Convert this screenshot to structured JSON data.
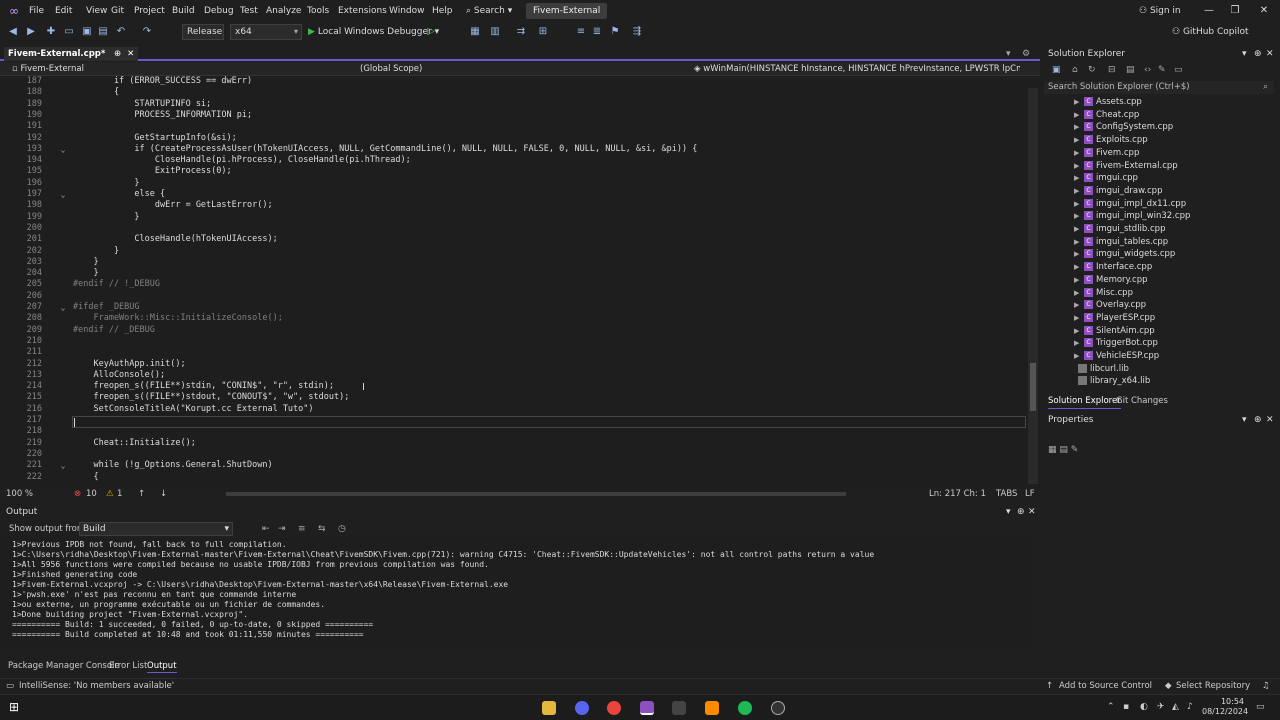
{
  "menubar": {
    "items": [
      "File",
      "Edit",
      "View",
      "Git",
      "Project",
      "Build",
      "Debug",
      "Test",
      "Analyze",
      "Tools",
      "Extensions",
      "Window",
      "Help"
    ],
    "search_label": "Search",
    "solution_title": "Fivem-External",
    "sign_in": "Sign in"
  },
  "toolbar": {
    "config": "Release",
    "platform": "x64",
    "run_target": "Local Windows Debugger",
    "copilot": "GitHub Copilot"
  },
  "document": {
    "tab_label": "Fivem-External.cpp*",
    "nav_project": "Fivem-External",
    "nav_scope": "(Global Scope)",
    "nav_function": "wWinMain(HINSTANCE hInstance, HINSTANCE hPrevInstance, LPWSTR lpCmdLine, int nC"
  },
  "editor": {
    "line_numbers": [
      "187",
      "188",
      "189",
      "190",
      "191",
      "192",
      "193",
      "194",
      "195",
      "196",
      "197",
      "198",
      "199",
      "200",
      "201",
      "202",
      "203",
      "204",
      "205",
      "206",
      "207",
      "208",
      "209",
      "210",
      "211",
      "212",
      "213",
      "214",
      "215",
      "216",
      "217",
      "218",
      "219",
      "220",
      "221",
      "222"
    ],
    "lines": [
      "        if (ERROR_SUCCESS == dwErr)",
      "        {",
      "            STARTUPINFO si;",
      "            PROCESS_INFORMATION pi;",
      "",
      "            GetStartupInfo(&si);",
      "            if (CreateProcessAsUser(hTokenUIAccess, NULL, GetCommandLine(), NULL, NULL, FALSE, 0, NULL, NULL, &si, &pi)) {",
      "                CloseHandle(pi.hProcess), CloseHandle(pi.hThread);",
      "                ExitProcess(0);",
      "            }",
      "            else {",
      "                dwErr = GetLastError();",
      "            }",
      "",
      "            CloseHandle(hTokenUIAccess);",
      "        }",
      "    }",
      "    }",
      "#endif // !_DEBUG",
      "",
      "#ifdef _DEBUG",
      "    FrameWork::Misc::InitializeConsole();",
      "#endif // _DEBUG",
      "",
      "",
      "    KeyAuthApp.init();",
      "    AlloConsole();",
      "    freopen_s((FILE**)stdin, \"CONIN$\", \"r\", stdin);",
      "    freopen_s((FILE**)stdout, \"CONOUT$\", \"w\", stdout);",
      "    SetConsoleTitleA(\"Korupt.cc External Tuto\")",
      "",
      "",
      "    Cheat::Initialize();",
      "",
      "    while (!g_Options.General.ShutDown)",
      "    {"
    ]
  },
  "editor_status": {
    "zoom": "100 %",
    "errors": "10",
    "warnings": "1",
    "position": "Ln: 217   Ch: 1",
    "tabs": "TABS",
    "eol": "LF"
  },
  "output": {
    "title": "Output",
    "show_from_label": "Show output from:",
    "source": "Build",
    "lines": [
      "1>Previous IPDB not found, fall back to full compilation.",
      "1>C:\\Users\\ridha\\Desktop\\Fivem-External-master\\Fivem-External\\Cheat\\FivemSDK\\Fivem.cpp(721): warning C4715: 'Cheat::FivemSDK::UpdateVehicles': not all control paths return a value",
      "1>All 5956 functions were compiled because no usable IPDB/IOBJ from previous compilation was found.",
      "1>Finished generating code",
      "1>Fivem-External.vcxproj -> C:\\Users\\ridha\\Desktop\\Fivem-External-master\\x64\\Release\\Fivem-External.exe",
      "1>'pwsh.exe' n'est pas reconnu en tant que commande interne",
      "1>ou externe, un programme exécutable ou un fichier de commandes.",
      "1>Done building project \"Fivem-External.vcxproj\".",
      "========== Build: 1 succeeded, 0 failed, 0 up-to-date, 0 skipped ==========",
      "========== Build completed at 10:48 and took 01:11,550 minutes =========="
    ]
  },
  "bottom_tabs": [
    "Package Manager Console",
    "Error List",
    "Output"
  ],
  "status_bar": {
    "message": "IntelliSense: 'No members available'",
    "add_source_control": "Add to Source Control",
    "select_repo": "Select Repository"
  },
  "solution_explorer": {
    "title": "Solution Explorer",
    "search_placeholder": "Search Solution Explorer (Ctrl+$)",
    "files": [
      "Assets.cpp",
      "Cheat.cpp",
      "ConfigSystem.cpp",
      "Exploits.cpp",
      "Fivem.cpp",
      "Fivem-External.cpp",
      "imgui.cpp",
      "imgui_draw.cpp",
      "imgui_impl_dx11.cpp",
      "imgui_impl_win32.cpp",
      "imgui_stdlib.cpp",
      "imgui_tables.cpp",
      "imgui_widgets.cpp",
      "Interface.cpp",
      "Memory.cpp",
      "Misc.cpp",
      "Overlay.cpp",
      "PlayerESP.cpp",
      "SilentAim.cpp",
      "TriggerBot.cpp",
      "VehicleESP.cpp"
    ],
    "libs": [
      "libcurl.lib",
      "library_x64.lib"
    ],
    "tab_solution": "Solution Explorer",
    "tab_git": "Git Changes"
  },
  "properties": {
    "title": "Properties"
  },
  "taskbar": {
    "time": "10:54",
    "date": "08/12/2024"
  },
  "colors": {
    "accent": "#6a5acd",
    "background": "#1e1e1e",
    "keyword": "#569cd6"
  }
}
